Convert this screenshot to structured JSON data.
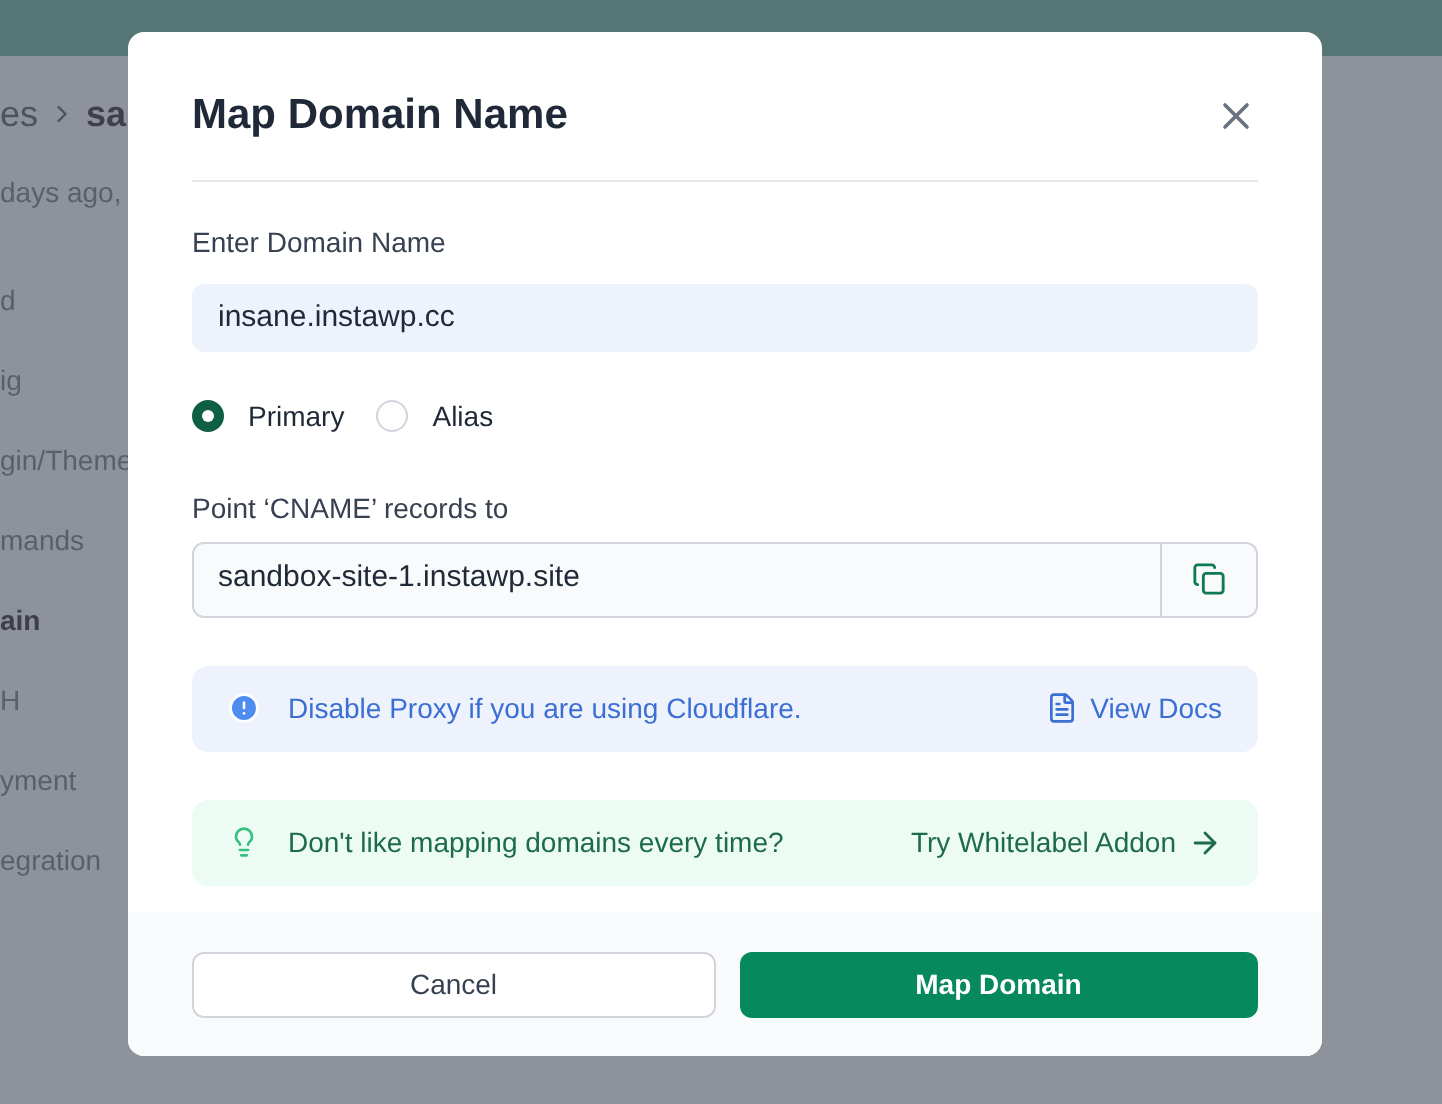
{
  "background": {
    "breadcrumb": [
      "es",
      "sa"
    ],
    "subtitle": "days ago,",
    "menu": [
      {
        "label": "d",
        "selected": false
      },
      {
        "label": "ig",
        "selected": false
      },
      {
        "label": "gin/Theme",
        "selected": false
      },
      {
        "label": "mands",
        "selected": false
      },
      {
        "label": "ain",
        "selected": true
      },
      {
        "label": "H",
        "selected": false
      },
      {
        "label": "yment",
        "selected": false
      },
      {
        "label": "egration",
        "selected": false
      }
    ]
  },
  "dialog": {
    "title": "Map Domain Name",
    "domain_label": "Enter Domain Name",
    "domain_value": "insane.instawp.cc",
    "options": [
      {
        "label": "Primary",
        "selected": true
      },
      {
        "label": "Alias",
        "selected": false
      }
    ],
    "cname_label": "Point ‘CNAME’ records to",
    "cname_value": "sandbox-site-1.instawp.site",
    "notices": [
      {
        "kind": "info",
        "text": "Disable Proxy if you are using Cloudflare.",
        "link": "View Docs"
      },
      {
        "kind": "tip",
        "text": "Don't like mapping domains every time?",
        "link": "Try Whitelabel Addon"
      }
    ],
    "buttons": [
      {
        "label": "Cancel",
        "kind": "secondary"
      },
      {
        "label": "Map Domain",
        "kind": "primary"
      }
    ]
  }
}
